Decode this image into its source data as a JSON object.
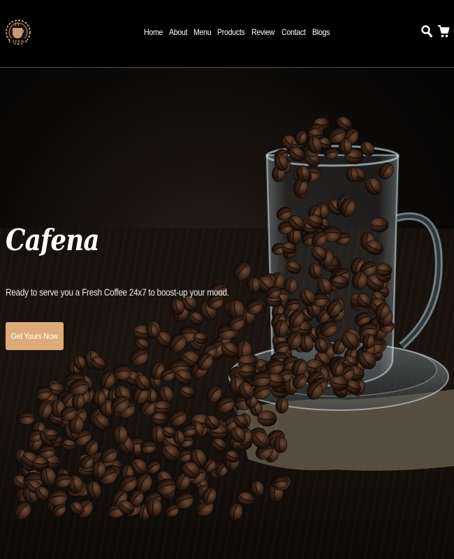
{
  "header": {
    "logo": {
      "text": "CAFENA",
      "icon": "coffee-cup-gear-logo"
    },
    "nav": [
      {
        "label": "Home"
      },
      {
        "label": "About"
      },
      {
        "label": "Menu"
      },
      {
        "label": "Products"
      },
      {
        "label": "Review"
      },
      {
        "label": "Contact"
      },
      {
        "label": "Blogs"
      }
    ],
    "icons": {
      "search": "search-icon",
      "cart": "shopping-cart-icon"
    }
  },
  "hero": {
    "title": "Cafena",
    "subtitle": "Ready to serve you a Fresh Coffee 24x7 to boost-up your mood.",
    "cta_label": "Get Yours Now",
    "image": "coffee-beans-in-glass-mug"
  },
  "colors": {
    "background": "#000000",
    "accent": "#dcab79",
    "text": "#ffffff"
  }
}
